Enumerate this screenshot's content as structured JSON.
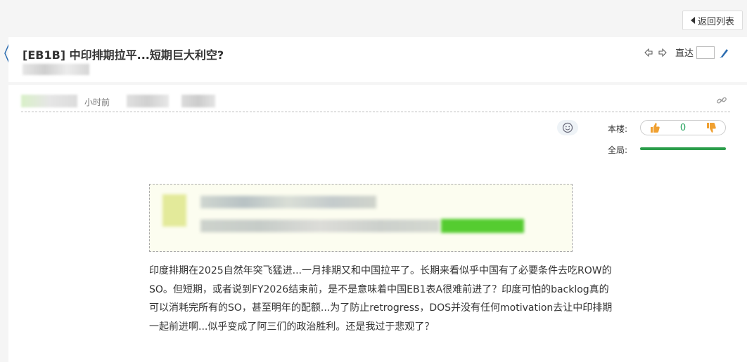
{
  "toolbar": {
    "back_label": "返回列表"
  },
  "thread": {
    "title": "[EB1B] 中印排期拉平...短期巨大利空?",
    "goto_label": "直达"
  },
  "post": {
    "time_text": "小时前",
    "vote": {
      "this_floor_label": "本楼:",
      "count": "0",
      "overall_label": "全局:",
      "overall_fraction": 1.0
    },
    "body": "印度排期在2025自然年突飞猛进...一月排期又和中国拉平了。长期来看似乎中国有了必要条件去吃ROW的SO。但短期，或者说到FY2026结束前，是不是意味着中国EB1表A很难前进了？印度可怕的backlog真的可以消耗完所有的SO，甚至明年的配额...为了防止retrogress，DOS并没有任何motivation去让中印排期一起前进啊...似乎变成了阿三们的政治胜利。还是我过于悲观了？"
  },
  "colors": {
    "accent": "#2a9d4a",
    "vote_count": "#22a05a",
    "thumb": "#f0a030"
  },
  "icons": [
    "arrow-left-icon",
    "arrow-right-icon",
    "pen-icon",
    "link-icon",
    "smile-icon",
    "thumbs-up-icon",
    "thumbs-down-icon"
  ]
}
